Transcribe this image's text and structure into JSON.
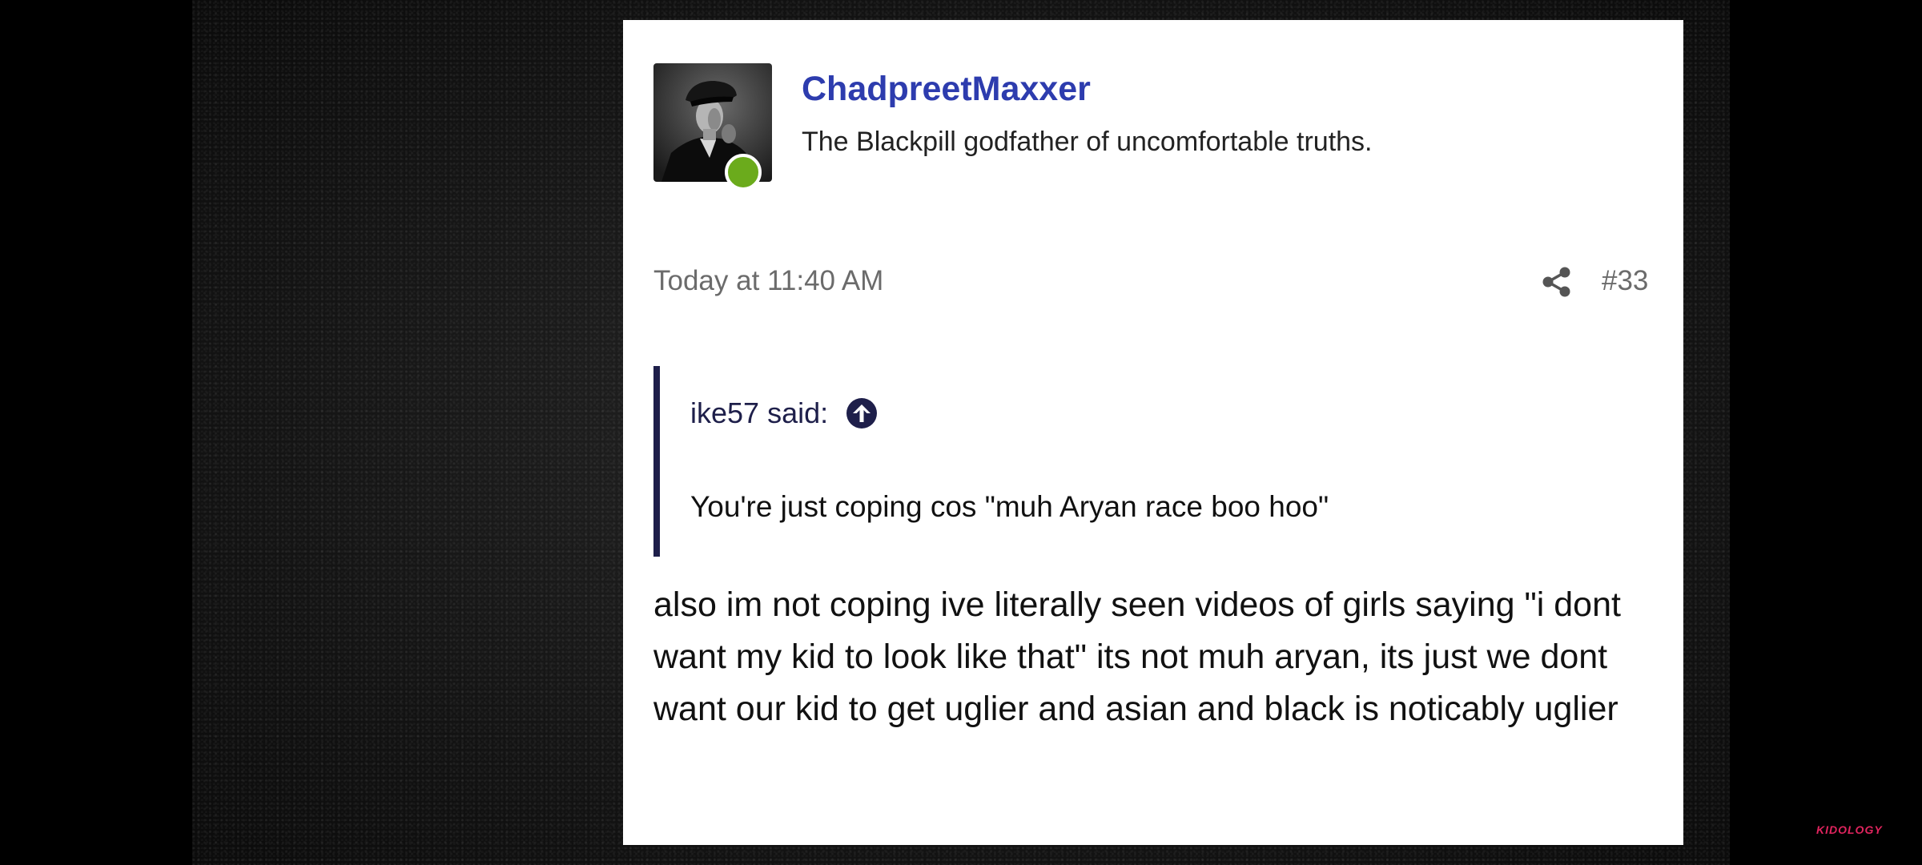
{
  "post": {
    "username": "ChadpreetMaxxer",
    "user_title": "The Blackpill godfather of uncomfortable truths.",
    "date": "Today at 11:40 AM",
    "number": "#33",
    "quote": {
      "author_label": "ike57 said:",
      "text": "You're just coping cos \"muh Aryan race boo hoo\""
    },
    "body": "also im not coping ive literally seen videos of girls saying \"i dont want my kid to look like that\" its not muh aryan, its just we dont want our kid to get uglier and asian and black is noticably uglier"
  },
  "icons": {
    "share": "share-icon",
    "jump": "arrow-up-circle-icon",
    "online": "online-status-dot"
  },
  "colors": {
    "username": "#2d3cae",
    "online": "#6bab1c",
    "quote_bar": "#1e1f4a",
    "watermark": "#e0245e"
  },
  "watermark": "KIDOLOGY"
}
